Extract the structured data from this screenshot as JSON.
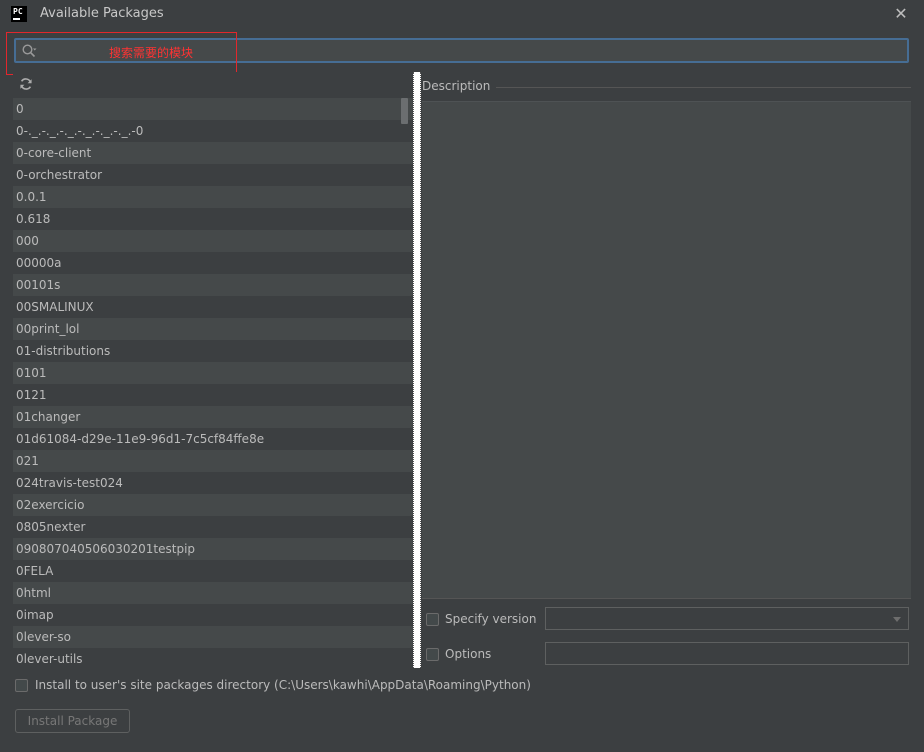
{
  "window": {
    "title": "Available Packages",
    "app_icon_text": "PC",
    "close_glyph": "✕"
  },
  "search": {
    "value": "",
    "placeholder": "",
    "icon": "search-icon"
  },
  "annotation": {
    "text": "搜索需要的模块",
    "color": "#e2272d"
  },
  "package_list": {
    "refresh_icon": "refresh-icon",
    "items": [
      "0",
      "0-._.-._.-._.-._.-._.-._.-0",
      "0-core-client",
      "0-orchestrator",
      "0.0.1",
      "0.618",
      "000",
      "00000a",
      "00101s",
      "00SMALINUX",
      "00print_lol",
      "01-distributions",
      "0101",
      "0121",
      "01changer",
      "01d61084-d29e-11e9-96d1-7c5cf84ffe8e",
      "021",
      "024travis-test024",
      "02exercicio",
      "0805nexter",
      "090807040506030201testpip",
      "0FELA",
      "0html",
      "0imap",
      "0lever-so",
      "0lever-utils"
    ]
  },
  "description": {
    "label": "Description"
  },
  "specify_version": {
    "label": "Specify version",
    "checked": false,
    "selected": ""
  },
  "options": {
    "label": "Options",
    "checked": false,
    "value": ""
  },
  "install_to_user": {
    "label": "Install to user's site packages directory (C:\\Users\\kawhi\\AppData\\Roaming\\Python)",
    "checked": false
  },
  "install_button": {
    "label": "Install Package"
  },
  "colors": {
    "background": "#3c3f41",
    "row_alt": "#45494a",
    "search_border": "#466d94",
    "text": "#bbbbbb"
  }
}
